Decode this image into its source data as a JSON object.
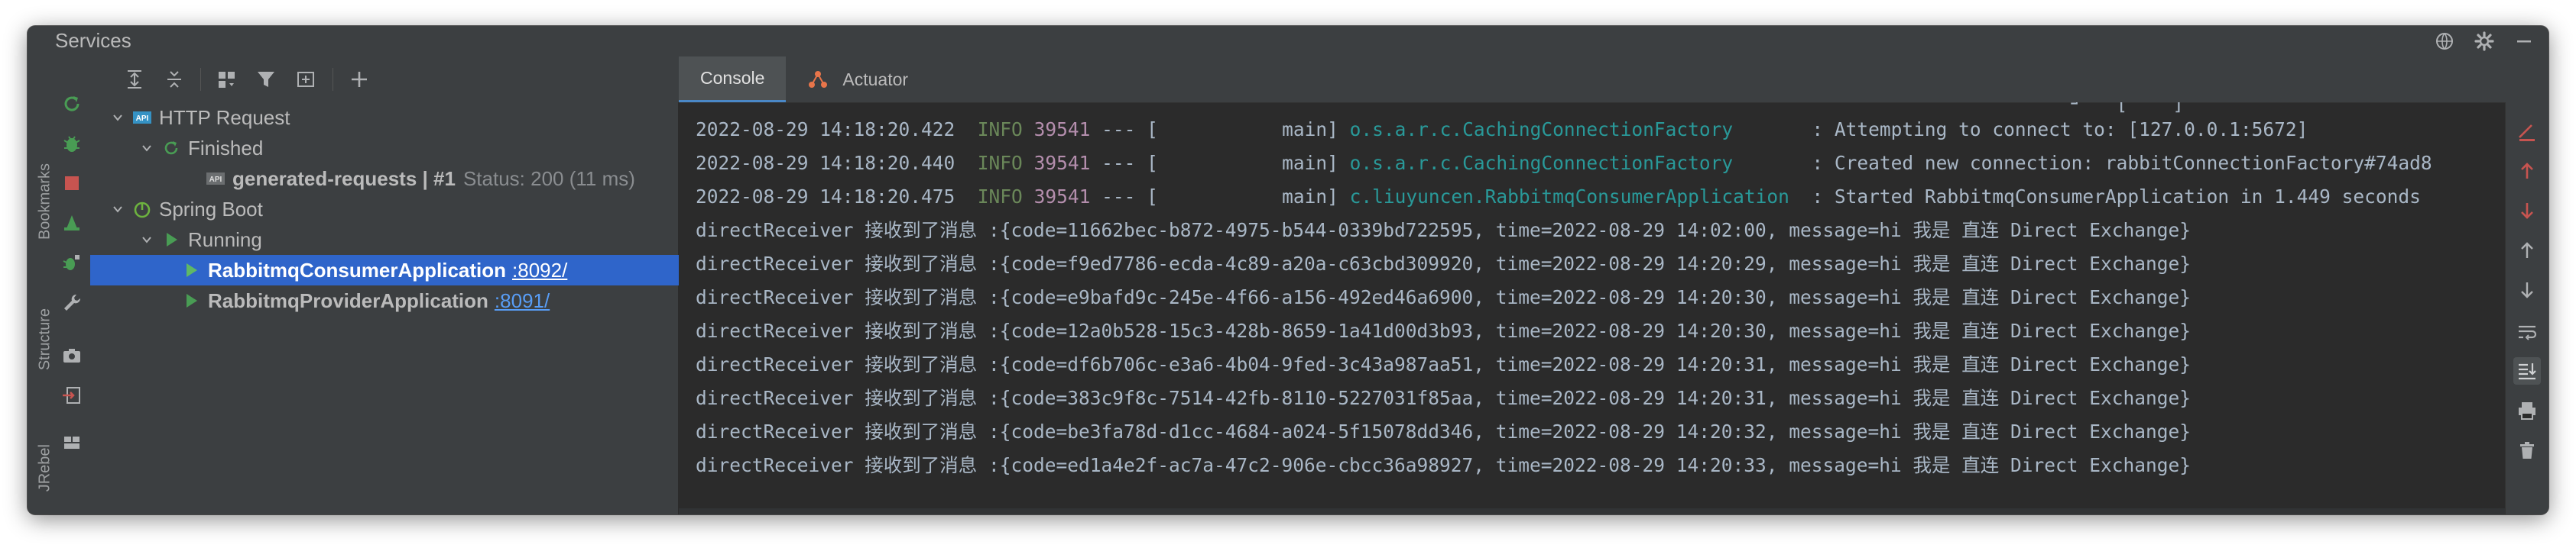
{
  "window": {
    "title": "Services"
  },
  "left_strip": {
    "tabs": [
      "Bookmarks",
      "Structure",
      "JRebel"
    ]
  },
  "tree": {
    "nodes": [
      {
        "label": "HTTP Request",
        "level": 0,
        "expanded": true
      },
      {
        "label": "Finished",
        "level": 1,
        "expanded": true
      },
      {
        "label": "generated-requests  |  #1",
        "level": 2,
        "status": "Status: 200 (11 ms)"
      },
      {
        "label": "Spring Boot",
        "level": 0,
        "expanded": true
      },
      {
        "label": "Running",
        "level": 1,
        "expanded": true
      },
      {
        "label": "RabbitmqConsumerApplication",
        "level": 2,
        "port": ":8092/",
        "selected": true
      },
      {
        "label": "RabbitmqProviderApplication",
        "level": 2,
        "port": ":8091/"
      }
    ]
  },
  "console_tabs": [
    "Console",
    "Actuator"
  ],
  "console": {
    "log_lines": [
      {
        "date": "2022-08-29 14:18:20.422",
        "level": "INFO",
        "pid": "39541",
        "sep": "--- [           main]",
        "logger": "o.s.a.r.c.CachingConnectionFactory      ",
        "message": " : Attempting to connect to: [127.0.0.1:5672]"
      },
      {
        "date": "2022-08-29 14:18:20.440",
        "level": "INFO",
        "pid": "39541",
        "sep": "--- [           main]",
        "logger": "o.s.a.r.c.CachingConnectionFactory      ",
        "message": " : Created new connection: rabbitConnectionFactory#74ad8"
      },
      {
        "date": "2022-08-29 14:18:20.475",
        "level": "INFO",
        "pid": "39541",
        "sep": "--- [           main]",
        "logger": "c.liuyuncen.RabbitmqConsumerApplication ",
        "message": " : Started RabbitmqConsumerApplication in 1.449 seconds"
      }
    ],
    "receiver_lines": [
      "directReceiver 接收到了消息 :{code=11662bec-b872-4975-b544-0339bd722595, time=2022-08-29 14:02:00, message=hi 我是 直连 Direct Exchange}",
      "directReceiver 接收到了消息 :{code=f9ed7786-ecda-4c89-a20a-c63cbd309920, time=2022-08-29 14:20:29, message=hi 我是 直连 Direct Exchange}",
      "directReceiver 接收到了消息 :{code=e9bafd9c-245e-4f66-a156-492ed46a6900, time=2022-08-29 14:20:30, message=hi 我是 直连 Direct Exchange}",
      "directReceiver 接收到了消息 :{code=12a0b528-15c3-428b-8659-1a41d00d3b93, time=2022-08-29 14:20:30, message=hi 我是 直连 Direct Exchange}",
      "directReceiver 接收到了消息 :{code=df6b706c-e3a6-4b04-9fed-3c43a987aa51, time=2022-08-29 14:20:31, message=hi 我是 直连 Direct Exchange}",
      "directReceiver 接收到了消息 :{code=383c9f8c-7514-42fb-8110-5227031f85aa, time=2022-08-29 14:20:31, message=hi 我是 直连 Direct Exchange}",
      "directReceiver 接收到了消息 :{code=be3fa78d-d1cc-4684-a024-5f15078dd346, time=2022-08-29 14:20:32, message=hi 我是 直连 Direct Exchange}",
      "directReceiver 接收到了消息 :{code=ed1a4e2f-ac7a-47c2-906e-cbcc36a98927, time=2022-08-29 14:20:33, message=hi 我是 直连 Direct Exchange}"
    ]
  },
  "colors": {
    "background": "#2b2b2b",
    "panel": "#3c3f41",
    "selection": "#2f65ca",
    "info_level": "#6a8759",
    "pid": "#b48ead",
    "logger": "#299999",
    "stop_red": "#c75450",
    "run_green": "#499c54"
  }
}
